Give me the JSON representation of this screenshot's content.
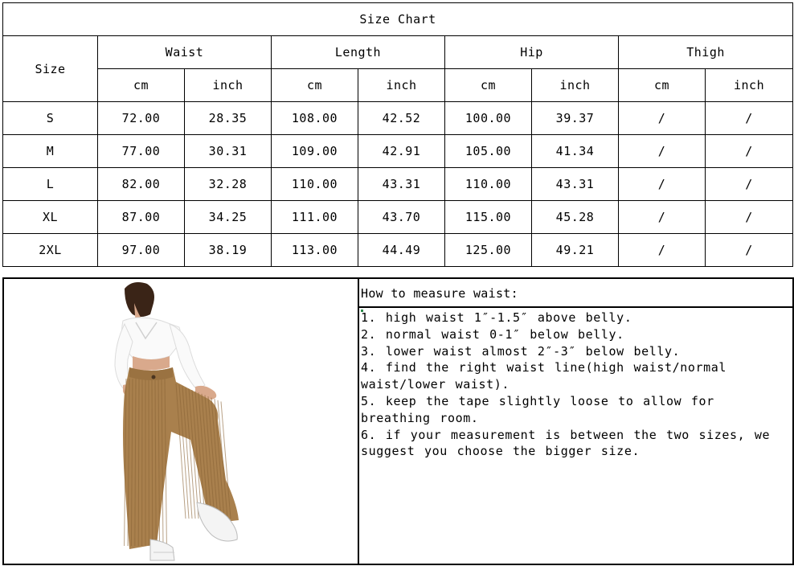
{
  "chart": {
    "title": "Size Chart",
    "size_header": "Size",
    "groups": [
      "Waist",
      "Length",
      "Hip",
      "Thigh"
    ],
    "units": [
      "cm",
      "inch",
      "cm",
      "inch",
      "cm",
      "inch",
      "cm",
      "inch"
    ],
    "rows": [
      {
        "size": "S",
        "values": [
          "72.00",
          "28.35",
          "108.00",
          "42.52",
          "100.00",
          "39.37",
          "/",
          "/"
        ]
      },
      {
        "size": "M",
        "values": [
          "77.00",
          "30.31",
          "109.00",
          "42.91",
          "105.00",
          "41.34",
          "/",
          "/"
        ]
      },
      {
        "size": "L",
        "values": [
          "82.00",
          "32.28",
          "110.00",
          "43.31",
          "110.00",
          "43.31",
          "/",
          "/"
        ]
      },
      {
        "size": "XL",
        "values": [
          "87.00",
          "34.25",
          "111.00",
          "43.70",
          "115.00",
          "45.28",
          "/",
          "/"
        ]
      },
      {
        "size": "2XL",
        "values": [
          "97.00",
          "38.19",
          "113.00",
          "44.49",
          "125.00",
          "49.21",
          "/",
          "/"
        ]
      }
    ]
  },
  "measure": {
    "title": "How to measure waist:",
    "steps": [
      "1. high waist 1″-1.5″ above belly.",
      "2. normal waist 0-1″ below belly.",
      "3. lower waist almost 2″-3″ below belly.",
      "4. find the right waist line(high waist/normal waist/lower waist).",
      "5. keep the tape slightly loose to allow for breathing room.",
      "6. if your measurement is between the two sizes, we suggest you choose the bigger size."
    ]
  },
  "colors": {
    "pants": "#a9804d",
    "pants_dark": "#8a6436",
    "top": "#fafafa",
    "skin": "#d9a98c",
    "hair": "#3a2417"
  }
}
